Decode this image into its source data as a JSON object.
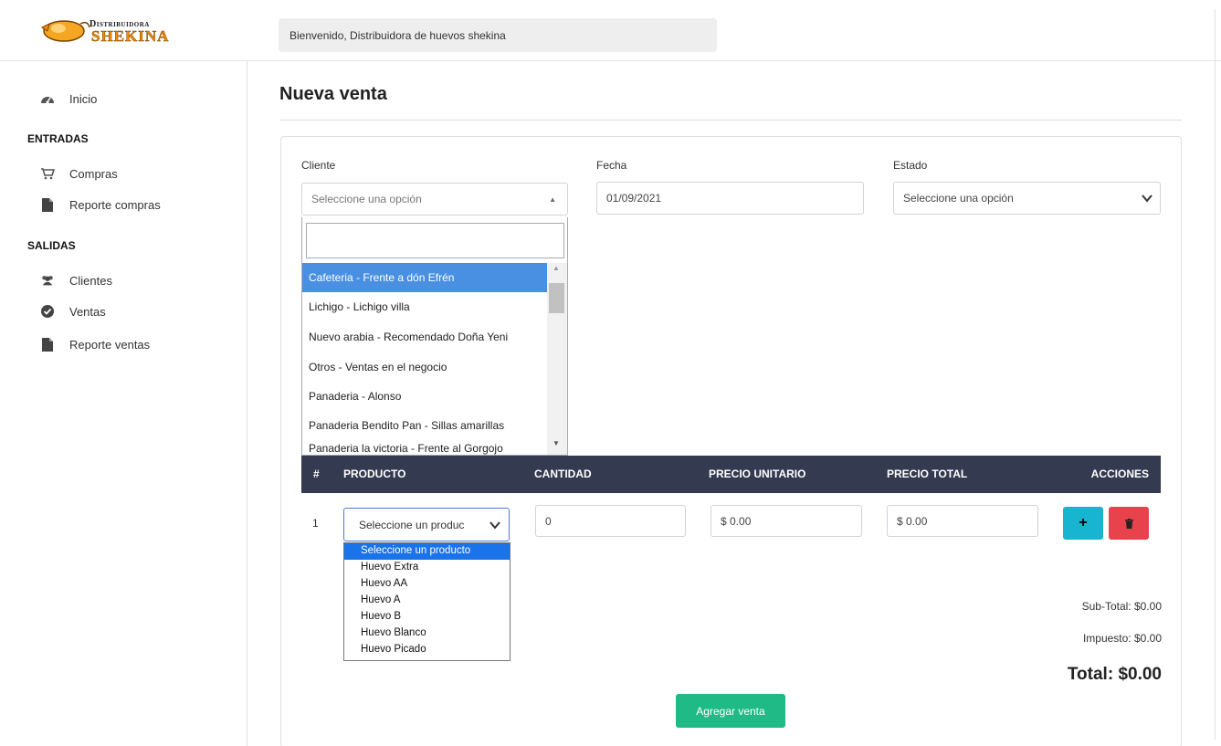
{
  "brand": {
    "line1": "Distribuidora",
    "line2": "SHEKINA",
    "accent_color": "#f28c00"
  },
  "header": {
    "welcome": "Bienvenido, Distribuidora de huevos shekina"
  },
  "sidebar": {
    "items": [
      {
        "label": "Inicio",
        "icon": "dashboard-icon"
      },
      {
        "section": "ENTRADAS"
      },
      {
        "label": "Compras",
        "icon": "cart-icon"
      },
      {
        "label": "Reporte compras",
        "icon": "file-icon"
      },
      {
        "section": "SALIDAS"
      },
      {
        "label": "Clientes",
        "icon": "users-icon"
      },
      {
        "label": "Ventas",
        "icon": "check-circle-icon"
      },
      {
        "label": "Reporte ventas",
        "icon": "file-icon"
      }
    ]
  },
  "page": {
    "title": "Nueva venta"
  },
  "form": {
    "cliente_label": "Cliente",
    "cliente_placeholder": "Seleccione una opción",
    "fecha_label": "Fecha",
    "fecha_value": "01/09/2021",
    "estado_label": "Estado",
    "estado_value": "Seleccione una opción",
    "client_options": [
      "Cafeteria - Frente a dón Efrén",
      "Lichigo - Lichigo villa",
      "Nuevo arabia - Recomendado Doña Yeni",
      "Otros - Ventas en el negocio",
      "Panaderia - Alonso",
      "Panaderia Bendito Pan - Sillas amarillas",
      "Panaderia la victoria - Frente al Gorgojo"
    ]
  },
  "table": {
    "headers": [
      "#",
      "PRODUCTO",
      "CANTIDAD",
      "PRECIO UNITARIO",
      "PRECIO TOTAL",
      "ACCIONES"
    ],
    "row": {
      "num": "1",
      "product_selected": "Seleccione un produc",
      "cantidad": "0",
      "precio_unitario": "$ 0.00",
      "precio_total": "$ 0.00",
      "add_label": "+"
    },
    "product_options": [
      "Seleccione un producto",
      "Huevo Extra",
      "Huevo AA",
      "Huevo A",
      "Huevo B",
      "Huevo Blanco",
      "Huevo Picado"
    ]
  },
  "summary": {
    "subtotal": "Sub-Total: $0.00",
    "impuesto": "Impuesto: $0.00",
    "total": "Total: $0.00"
  },
  "actions": {
    "submit_label": "Agregar venta"
  },
  "colors": {
    "table_header": "#343a4f",
    "add_button": "#17b5d0",
    "delete_button": "#e8434d",
    "submit_button": "#1fba86",
    "selected_option": "#4a90e2"
  }
}
